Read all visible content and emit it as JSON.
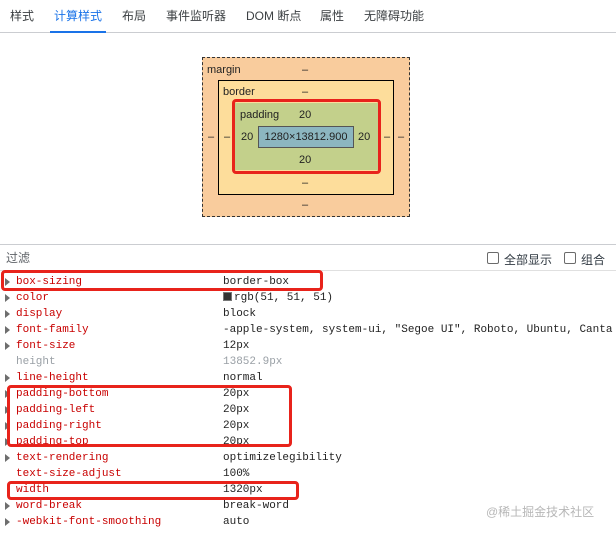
{
  "tabs": [
    {
      "label": "样式"
    },
    {
      "label": "计算样式"
    },
    {
      "label": "布局"
    },
    {
      "label": "事件监听器"
    },
    {
      "label": "DOM 断点"
    },
    {
      "label": "属性"
    },
    {
      "label": "无障碍功能"
    }
  ],
  "active_tab": "计算样式",
  "box_model": {
    "margin_label": "margin",
    "margin_top": "–",
    "margin_bottom": "–",
    "margin_left": "–",
    "margin_right": "–",
    "border_label": "border",
    "border_top": "–",
    "border_bottom": "–",
    "border_left": "–",
    "border_right": "–",
    "padding_label": "padding",
    "padding_top": "20",
    "padding_bottom": "20",
    "padding_left": "20",
    "padding_right": "20",
    "content": "1280×13812.900"
  },
  "filter": {
    "placeholder": "过滤",
    "show_all_label": "全部显示",
    "group_label": "组合"
  },
  "properties": [
    {
      "name": "box-sizing",
      "value": "border-box"
    },
    {
      "name": "color",
      "value": "rgb(51, 51, 51)",
      "swatch": "#333333"
    },
    {
      "name": "display",
      "value": "block"
    },
    {
      "name": "font-family",
      "value": "-apple-system, system-ui, \"Segoe UI\", Roboto, Ubuntu, Canta"
    },
    {
      "name": "font-size",
      "value": "12px"
    },
    {
      "name": "height",
      "value": "13852.9px"
    },
    {
      "name": "line-height",
      "value": "normal"
    },
    {
      "name": "padding-bottom",
      "value": "20px"
    },
    {
      "name": "padding-left",
      "value": "20px"
    },
    {
      "name": "padding-right",
      "value": "20px"
    },
    {
      "name": "padding-top",
      "value": "20px"
    },
    {
      "name": "text-rendering",
      "value": "optimizelegibility"
    },
    {
      "name": "text-size-adjust",
      "value": "100%"
    },
    {
      "name": "width",
      "value": "1320px"
    },
    {
      "name": "word-break",
      "value": "break-word"
    },
    {
      "name": "-webkit-font-smoothing",
      "value": "auto"
    }
  ],
  "watermark": "@稀土掘金技术社区",
  "colors": {
    "accent": "#1a73e8",
    "property_name": "#c80000",
    "highlight": "#e8231b",
    "margin_box": "#f9cc9d",
    "border_box": "#fddd9b",
    "padding_box": "#c3d08b",
    "content_box": "#8cb6c0"
  }
}
